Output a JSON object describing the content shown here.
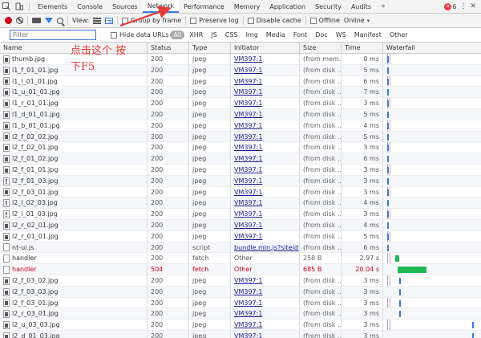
{
  "tabbar": {
    "tabs": [
      "Elements",
      "Console",
      "Sources",
      "Network",
      "Performance",
      "Memory",
      "Application",
      "Security",
      "Audits"
    ],
    "active_tab": "Network",
    "more": "»",
    "error_count": "6",
    "kebab": "⋮",
    "close": "✕"
  },
  "toolbar": {
    "view_label": "View:",
    "group_by_frame": "Group by frame",
    "preserve_log": "Preserve log",
    "disable_cache": "Disable cache",
    "offline": "Offline",
    "throttle": "Online",
    "throttle_arrow": "▾"
  },
  "filterbar": {
    "placeholder": "Filter",
    "hide_data_urls": "Hide data URLs",
    "types": [
      "All",
      "XHR",
      "JS",
      "CSS",
      "Img",
      "Media",
      "Font",
      "Doc",
      "WS",
      "Manifest",
      "Other"
    ],
    "active_type": "All"
  },
  "columns": [
    "Name",
    "Status",
    "Type",
    "Initiator",
    "Size",
    "Time",
    "Waterfall"
  ],
  "rows": [
    {
      "name": "thumb.jpg",
      "icon": "image-file-icon",
      "status": "200",
      "type": "jpeg",
      "initiator": "VM397:1",
      "size": "(from mem...",
      "time": "0 ms"
    },
    {
      "name": "l1_f_01_01.jpg",
      "icon": "image-file-icon",
      "status": "200",
      "type": "jpeg",
      "initiator": "VM397:1",
      "size": "(from disk ...",
      "time": "5 ms"
    },
    {
      "name": "l1_l_01_01.jpg",
      "icon": "image-file-icon",
      "status": "200",
      "type": "jpeg",
      "initiator": "VM397:1",
      "size": "(from disk ...",
      "time": "6 ms"
    },
    {
      "name": "l1_u_01_01.jpg",
      "icon": "image-file-icon",
      "status": "200",
      "type": "jpeg",
      "initiator": "VM397:1",
      "size": "(from disk ...",
      "time": "7 ms"
    },
    {
      "name": "l1_r_01_01.jpg",
      "icon": "image-file-icon",
      "status": "200",
      "type": "jpeg",
      "initiator": "VM397:1",
      "size": "(from disk ...",
      "time": "3 ms"
    },
    {
      "name": "l1_d_01_01.jpg",
      "icon": "image-file-icon",
      "status": "200",
      "type": "jpeg",
      "initiator": "VM397:1",
      "size": "(from disk ...",
      "time": "5 ms"
    },
    {
      "name": "l1_b_01_01.jpg",
      "icon": "image-file-icon",
      "status": "200",
      "type": "jpeg",
      "initiator": "VM397:1",
      "size": "(from disk ...",
      "time": "4 ms"
    },
    {
      "name": "l2_f_02_02.jpg",
      "icon": "image-file-icon",
      "status": "200",
      "type": "jpeg",
      "initiator": "VM397:1",
      "size": "(from disk ...",
      "time": "5 ms"
    },
    {
      "name": "l2_f_02_01.jpg",
      "icon": "image-file-icon",
      "status": "200",
      "type": "jpeg",
      "initiator": "VM397:1",
      "size": "(from disk ...",
      "time": "3 ms"
    },
    {
      "name": "l2_f_01_02.jpg",
      "icon": "image-file-icon",
      "status": "200",
      "type": "jpeg",
      "initiator": "VM397:1",
      "size": "(from disk ...",
      "time": "6 ms"
    },
    {
      "name": "l2_f_01_01.jpg",
      "icon": "image-file-icon",
      "status": "200",
      "type": "jpeg",
      "initiator": "VM397:1",
      "size": "(from disk ...",
      "time": "3 ms"
    },
    {
      "name": "l2_f_01_03.jpg",
      "icon": "warning-file-icon",
      "status": "200",
      "type": "jpeg",
      "initiator": "VM397:1",
      "size": "(from disk ...",
      "time": "3 ms"
    },
    {
      "name": "l2_f_03_01.jpg",
      "icon": "image-file-icon",
      "status": "200",
      "type": "jpeg",
      "initiator": "VM397:1",
      "size": "(from disk ...",
      "time": "3 ms"
    },
    {
      "name": "l2_l_02_03.jpg",
      "icon": "warning-file-icon",
      "status": "200",
      "type": "jpeg",
      "initiator": "VM397:1",
      "size": "(from disk ...",
      "time": "4 ms"
    },
    {
      "name": "l2_l_01_03.jpg",
      "icon": "warning-file-icon",
      "status": "200",
      "type": "jpeg",
      "initiator": "VM397:1",
      "size": "(from disk ...",
      "time": "3 ms"
    },
    {
      "name": "l2_r_02_01.jpg",
      "icon": "image-file-icon",
      "status": "200",
      "type": "jpeg",
      "initiator": "VM397:1",
      "size": "(from disk ...",
      "time": "4 ms"
    },
    {
      "name": "l2_r_01_01.jpg",
      "icon": "image-file-icon",
      "status": "200",
      "type": "jpeg",
      "initiator": "VM397:1",
      "size": "(from disk ...",
      "time": "5 ms"
    },
    {
      "name": "nt-ui.js",
      "icon": "document-file-icon",
      "status": "200",
      "type": "script",
      "initiator": "bundle.min.js?siteid=...",
      "size": "(from disk ...",
      "time": "6 ms"
    },
    {
      "name": "handler",
      "icon": "document-file-icon",
      "status": "200",
      "type": "fetch",
      "initiator": "Other",
      "size": "258 B",
      "time": "2.97 s"
    },
    {
      "name": "handler",
      "icon": "document-file-icon",
      "status": "504",
      "type": "fetch",
      "initiator": "Other",
      "size": "685 B",
      "time": "20.04 s",
      "error": true
    },
    {
      "name": "l2_f_03_02.jpg",
      "icon": "image-file-icon",
      "status": "200",
      "type": "jpeg",
      "initiator": "VM397:1",
      "size": "(from disk ...",
      "time": "3 ms"
    },
    {
      "name": "l2_f_03_03.jpg",
      "icon": "image-file-icon",
      "status": "200",
      "type": "jpeg",
      "initiator": "VM397:1",
      "size": "(from disk ...",
      "time": "3 ms"
    },
    {
      "name": "l2_f_03_01.jpg",
      "icon": "image-file-icon",
      "status": "200",
      "type": "jpeg",
      "initiator": "VM397:1",
      "size": "(from disk ...",
      "time": "3 ms"
    },
    {
      "name": "l2_r_03_01.jpg",
      "icon": "image-file-icon",
      "status": "200",
      "type": "jpeg",
      "initiator": "VM397:1",
      "size": "(from disk ...",
      "time": "3 ms"
    },
    {
      "name": "l2_u_03_03.jpg",
      "icon": "image-file-icon",
      "status": "200",
      "type": "jpeg",
      "initiator": "VM397:1",
      "size": "(from disk ...",
      "time": "3 ms"
    },
    {
      "name": "l2_d_01_03.jpg",
      "icon": "image-file-icon",
      "status": "200",
      "type": "jpeg",
      "initiator": "VM397:1",
      "size": "(from disk ...",
      "time": "3 ms"
    }
  ],
  "annotation": {
    "line1": "点击这个  按",
    "line2": "下F5",
    "color": "#e53935"
  },
  "colors": {
    "accent": "#3879d9",
    "error": "#d0021b",
    "bar_ok": "#1db954"
  }
}
